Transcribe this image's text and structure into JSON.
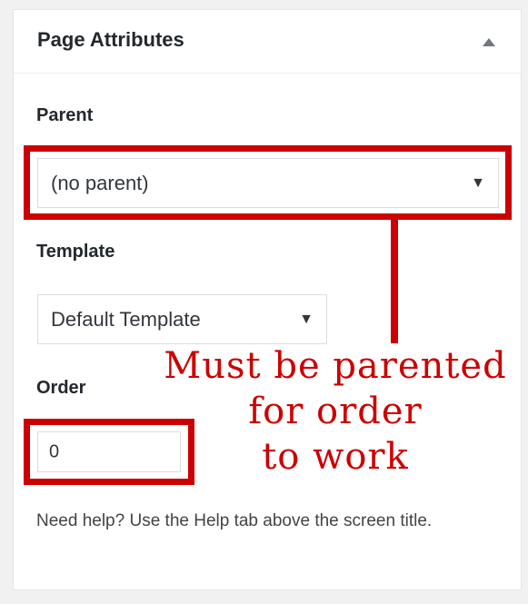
{
  "panel": {
    "title": "Page Attributes",
    "toggle_icon": "triangle-up-icon"
  },
  "parent": {
    "label": "Parent",
    "selected": "(no parent)",
    "caret_icon": "caret-down-icon"
  },
  "template": {
    "label": "Template",
    "selected": "Default Template",
    "caret_icon": "caret-down-icon"
  },
  "order": {
    "label": "Order",
    "value": "0"
  },
  "annotation": {
    "line1": "Must be parented",
    "line2": "for order",
    "line3": "to work",
    "color": "#cc0000"
  },
  "help": {
    "text": "Need help? Use the Help tab above the screen title."
  }
}
